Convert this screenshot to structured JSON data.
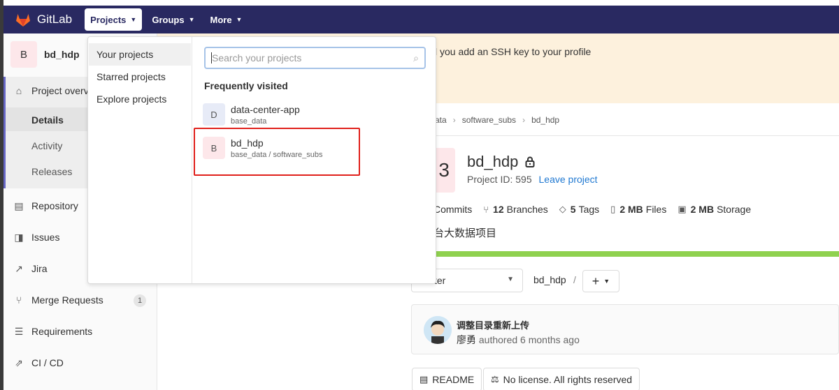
{
  "navbar": {
    "brand": "GitLab",
    "projects_label": "Projects",
    "groups_label": "Groups",
    "more_label": "More"
  },
  "sidebar": {
    "project_initial": "B",
    "project_name": "bd_hdp",
    "items": [
      {
        "label": "Project overview",
        "icon": "home-icon"
      },
      {
        "label": "Details"
      },
      {
        "label": "Activity"
      },
      {
        "label": "Releases"
      },
      {
        "label": "Repository",
        "icon": "repository-icon"
      },
      {
        "label": "Issues",
        "icon": "issues-icon"
      },
      {
        "label": "Jira",
        "icon": "external-link-icon"
      },
      {
        "label": "Merge Requests",
        "icon": "merge-request-icon",
        "badge": "1"
      },
      {
        "label": "Requirements",
        "icon": "requirements-icon"
      },
      {
        "label": "CI / CD",
        "icon": "rocket-icon"
      }
    ]
  },
  "alert": {
    "text": "l you add an SSH key to your profile"
  },
  "breadcrumb": [
    "ata",
    "software_subs",
    "bd_hdp"
  ],
  "project": {
    "avatar_letter": "3",
    "title": "bd_hdp",
    "id_label": "Project ID: 595",
    "leave_label": "Leave project",
    "description": "台大数据项目"
  },
  "stats": {
    "commits_label": "Commits",
    "branches_count": "12",
    "branches_label": "Branches",
    "tags_count": "5",
    "tags_label": "Tags",
    "files_size": "2 MB",
    "files_label": "Files",
    "storage_size": "2 MB",
    "storage_label": "Storage"
  },
  "repo_nav": {
    "branch_value": "ter",
    "path_root": "bd_hdp",
    "path_sep": "/"
  },
  "commit": {
    "title": "调整目录重新上传",
    "author": "廖勇",
    "meta": "authored 6 months ago"
  },
  "pills": {
    "readme": "README",
    "license": "No license. All rights reserved"
  },
  "dropdown": {
    "links": [
      "Your projects",
      "Starred projects",
      "Explore projects"
    ],
    "search_placeholder": "Search your projects",
    "heading": "Frequently visited",
    "items": [
      {
        "initial": "D",
        "name": "data-center-app",
        "namespace": "base_data",
        "color": "#e7ebf7"
      },
      {
        "initial": "B",
        "name": "bd_hdp",
        "namespace": "base_data / software_subs",
        "color": "#fde7ea"
      }
    ]
  },
  "colors": {
    "navbar": "#292961",
    "alert": "#fdf1dd",
    "progress": "#8fd14f",
    "highlight": "#e0201b",
    "link": "#1f78d1"
  }
}
